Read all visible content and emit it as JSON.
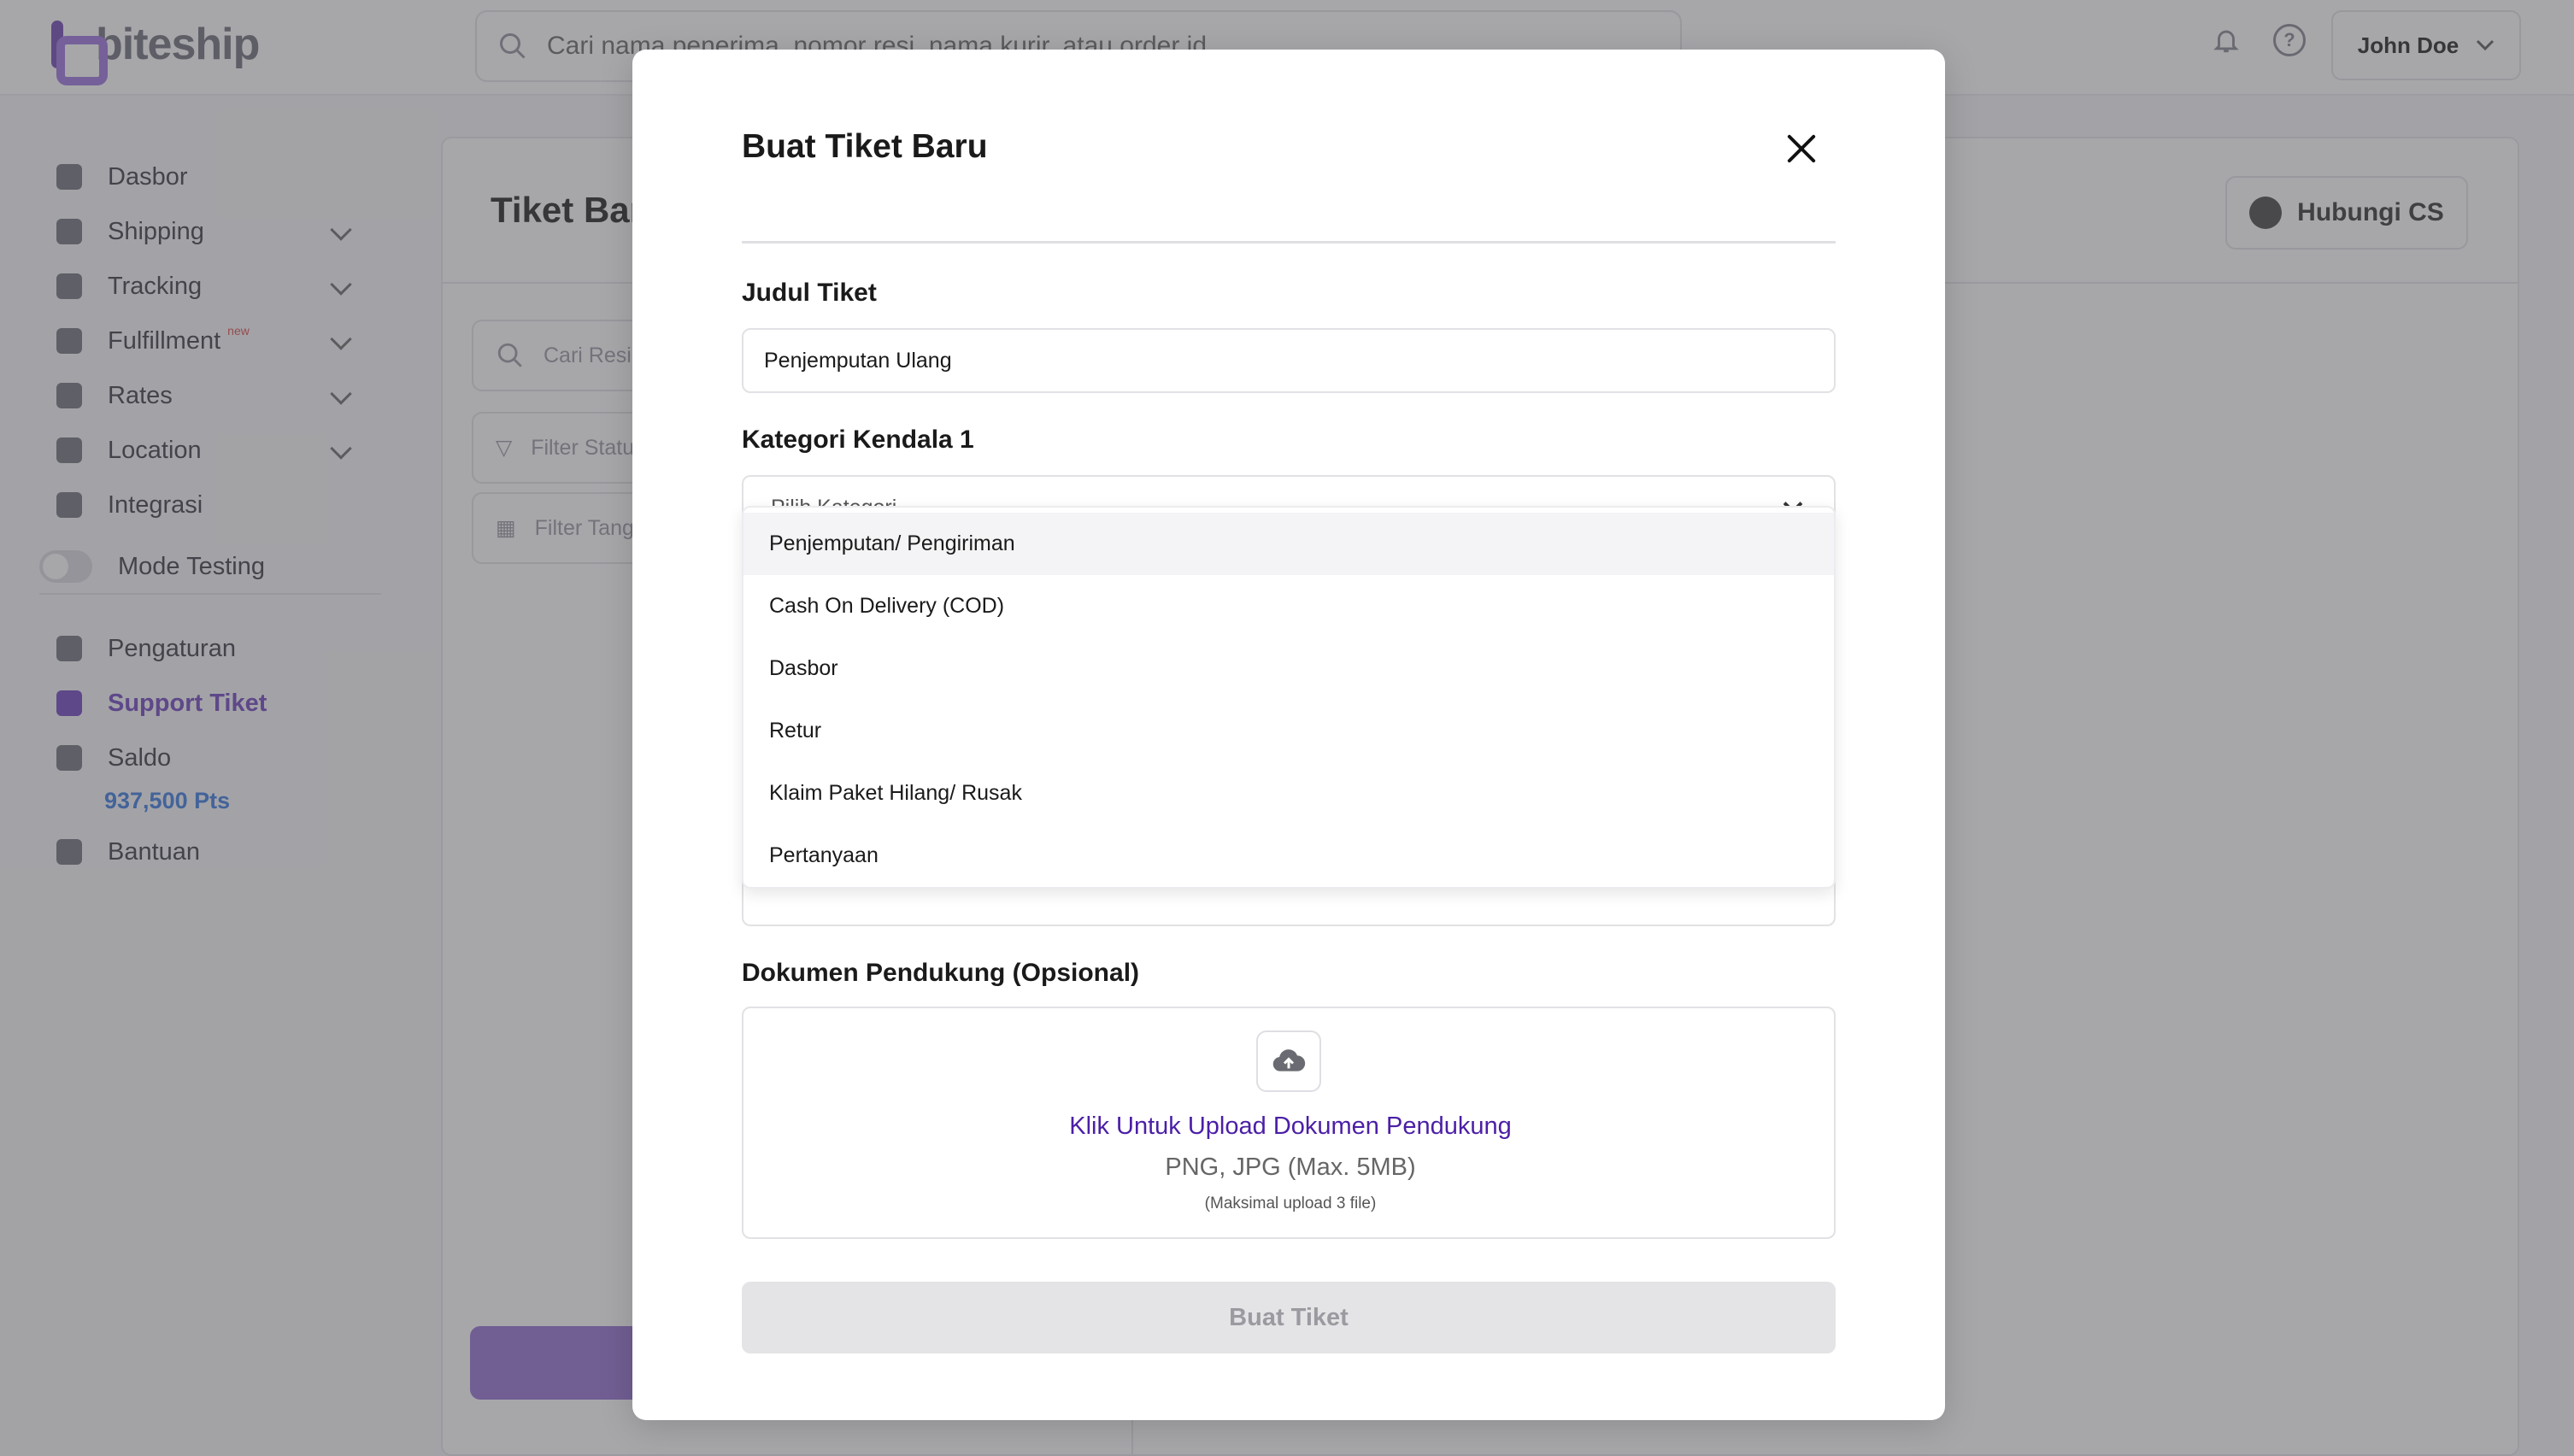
{
  "brand": {
    "name": "biteship"
  },
  "header": {
    "search_placeholder": "Cari nama penerima, nomor resi, nama kurir, atau order id",
    "user_name": "John Doe"
  },
  "sidebar": {
    "items": [
      {
        "label": "Dasbor"
      },
      {
        "label": "Shipping"
      },
      {
        "label": "Tracking"
      },
      {
        "label": "Fulfillment",
        "badge": "new"
      },
      {
        "label": "Rates"
      },
      {
        "label": "Location"
      },
      {
        "label": "Integrasi"
      },
      {
        "label": "Mode Testing"
      },
      {
        "label": "Pengaturan"
      },
      {
        "label": "Support Tiket"
      },
      {
        "label": "Saldo"
      },
      {
        "label": "Bantuan"
      }
    ],
    "balance": "937,500 Pts"
  },
  "page": {
    "title": "Tiket Bar",
    "contact_button": "Hubungi CS",
    "search_placeholder": "Cari Resi",
    "filter_status": "Filter Statu",
    "filter_date": "Filter Tang",
    "ghost_text": "t"
  },
  "modal": {
    "title": "Buat Tiket Baru",
    "ticket_title_label": "Judul Tiket",
    "ticket_title_value": "Penjemputan Ulang",
    "category_label": "Kategori Kendala 1",
    "category_placeholder": "Pilih Kategori",
    "category_options": [
      "Penjemputan/ Pengiriman",
      "Cash On Delivery (COD)",
      "Dasbor",
      "Retur",
      "Klaim Paket Hilang/ Rusak",
      "Pertanyaan"
    ],
    "documents_label": "Dokumen Pendukung (Opsional)",
    "upload_link": "Klik Untuk Upload Dokumen Pendukung",
    "upload_types": "PNG, JPG (Max. 5MB)",
    "upload_max": "(Maksimal upload 3 file)",
    "submit_label": "Buat Tiket"
  },
  "colors": {
    "accent": "#7a52c4",
    "link": "#4b1fa6",
    "disabled_button": "#e4e4e6"
  }
}
